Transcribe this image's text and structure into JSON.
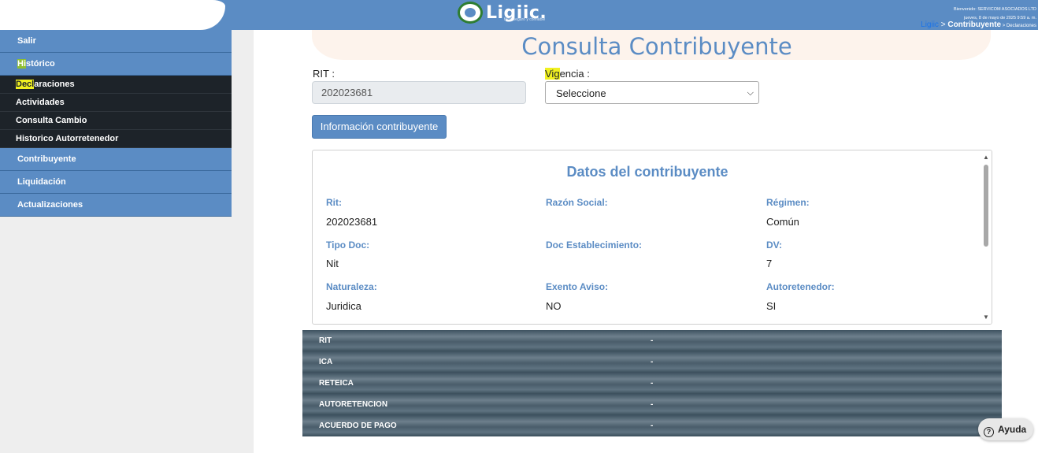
{
  "header": {
    "logo_text": "Ligiic.",
    "logo_sub": "fácil, seguro y confiable",
    "welcome_line1": "Bienvenido: SERVICOM ASOCIADOS LTD",
    "welcome_line2": "jueves, 8 de mayo de 2025 9:59 a. m.",
    "breadcrumb_home": "Ligiic",
    "breadcrumb_sep1": " > ",
    "breadcrumb_current": "Contribuyente",
    "breadcrumb_sep2": " > ",
    "breadcrumb_last": "Declaraciones"
  },
  "sidebar": {
    "salir": "Salir",
    "historico": "Histórico",
    "sub_items": [
      "Declaraciones",
      "Actividades",
      "Consulta Cambio",
      "Historico Autorretenedor"
    ],
    "contribuyente": "Contribuyente",
    "liquidacion": "Liquidación",
    "actualizaciones": "Actualizaciones"
  },
  "page": {
    "title": "Consulta Contribuyente",
    "rit_label": "RIT :",
    "rit_value": "202023681",
    "vigencia_label": "Vigencia :",
    "vigencia_value": "Seleccione",
    "info_button": "Información contribuyente"
  },
  "card": {
    "title": "Datos del contribuyente",
    "fields": [
      {
        "label": "Rit:",
        "value": "202023681"
      },
      {
        "label": "Razón Social:",
        "value": ""
      },
      {
        "label": "Régimen:",
        "value": "Común"
      },
      {
        "label": "Tipo Doc:",
        "value": "Nit"
      },
      {
        "label": "Doc Establecimiento:",
        "value": ""
      },
      {
        "label": "DV:",
        "value": "7"
      },
      {
        "label": "Naturaleza:",
        "value": "Juridica"
      },
      {
        "label": "Exento Aviso:",
        "value": "NO"
      },
      {
        "label": "Autoretenedor:",
        "value": "SI"
      }
    ]
  },
  "accordion": {
    "rows": [
      {
        "label": "RIT",
        "marker": "-"
      },
      {
        "label": "ICA",
        "marker": "-"
      },
      {
        "label": "RETEICA",
        "marker": "-"
      },
      {
        "label": "AUTORETENCION",
        "marker": "-"
      },
      {
        "label": "ACUERDO DE PAGO",
        "marker": "-"
      }
    ]
  },
  "help": {
    "label": "Ayuda",
    "icon": "?"
  }
}
